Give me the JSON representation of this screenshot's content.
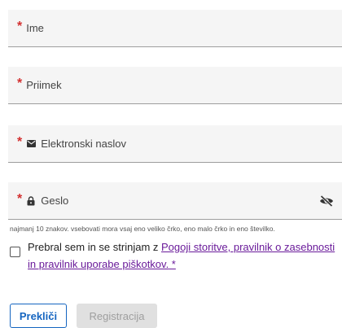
{
  "form": {
    "fields": [
      {
        "label": "Ime",
        "required_mark": "*"
      },
      {
        "label": "Priimek",
        "required_mark": "*"
      },
      {
        "label": "Elektronski naslov",
        "required_mark": "*",
        "icon": "mail-icon"
      },
      {
        "label": "Geslo",
        "required_mark": "*",
        "icon": "lock-icon",
        "trailing_icon": "eye-off-icon"
      }
    ],
    "password_hint": "najmanj 10 znakov. vsebovati mora vsaj eno veliko črko, eno malo črko in eno številko.",
    "consent": {
      "text_before": "Prebral sem in se strinjam z ",
      "link_text": "Pogoji storitve, pravilnik o zasebnosti in pravilnik uporabe piškotkov.",
      "text_after": " *"
    },
    "buttons": {
      "cancel_label": "Prekliči",
      "register_label": "Registracija"
    }
  },
  "colors": {
    "required": "#d32f2f",
    "link": "#6a1b9a",
    "primary": "#1565c0",
    "field_bg": "#f5f5f5",
    "disabled_bg": "#e0e0e0"
  }
}
